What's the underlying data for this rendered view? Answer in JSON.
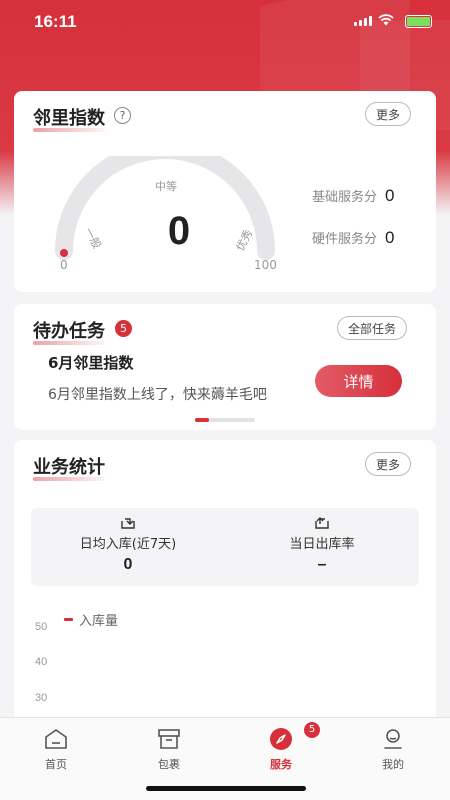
{
  "status": {
    "time": "16:11"
  },
  "index_card": {
    "title": "邻里指数",
    "more": "更多",
    "help": "?",
    "score": "0",
    "gauge_mid": "中等",
    "gauge_low": "一般",
    "gauge_high": "优秀",
    "gauge_min": "0",
    "gauge_max": "100",
    "basic_label": "基础服务分",
    "basic_value": "0",
    "hardware_label": "硬件服务分",
    "hardware_value": "0"
  },
  "todo_card": {
    "title": "待办任务",
    "badge": "5",
    "all_tasks": "全部任务",
    "task_title": "6月邻里指数",
    "task_desc": "6月邻里指数上线了，快来薅羊毛吧",
    "detail": "详情"
  },
  "stats_card": {
    "title": "业务统计",
    "more": "更多",
    "inbound_label": "日均入库(近7天)",
    "inbound_value": "0",
    "outbound_label": "当日出库率",
    "outbound_value": "–",
    "legend": "入库量",
    "yticks": [
      "50",
      "40",
      "30"
    ]
  },
  "tabbar": {
    "tabs": [
      {
        "label": "首页",
        "icon": "home-icon"
      },
      {
        "label": "包裹",
        "icon": "package-icon"
      },
      {
        "label": "服务",
        "icon": "compass-icon",
        "active": true
      },
      {
        "label": "我的",
        "icon": "user-icon"
      }
    ],
    "service_badge": "5"
  },
  "colors": {
    "accent": "#d6303b"
  }
}
